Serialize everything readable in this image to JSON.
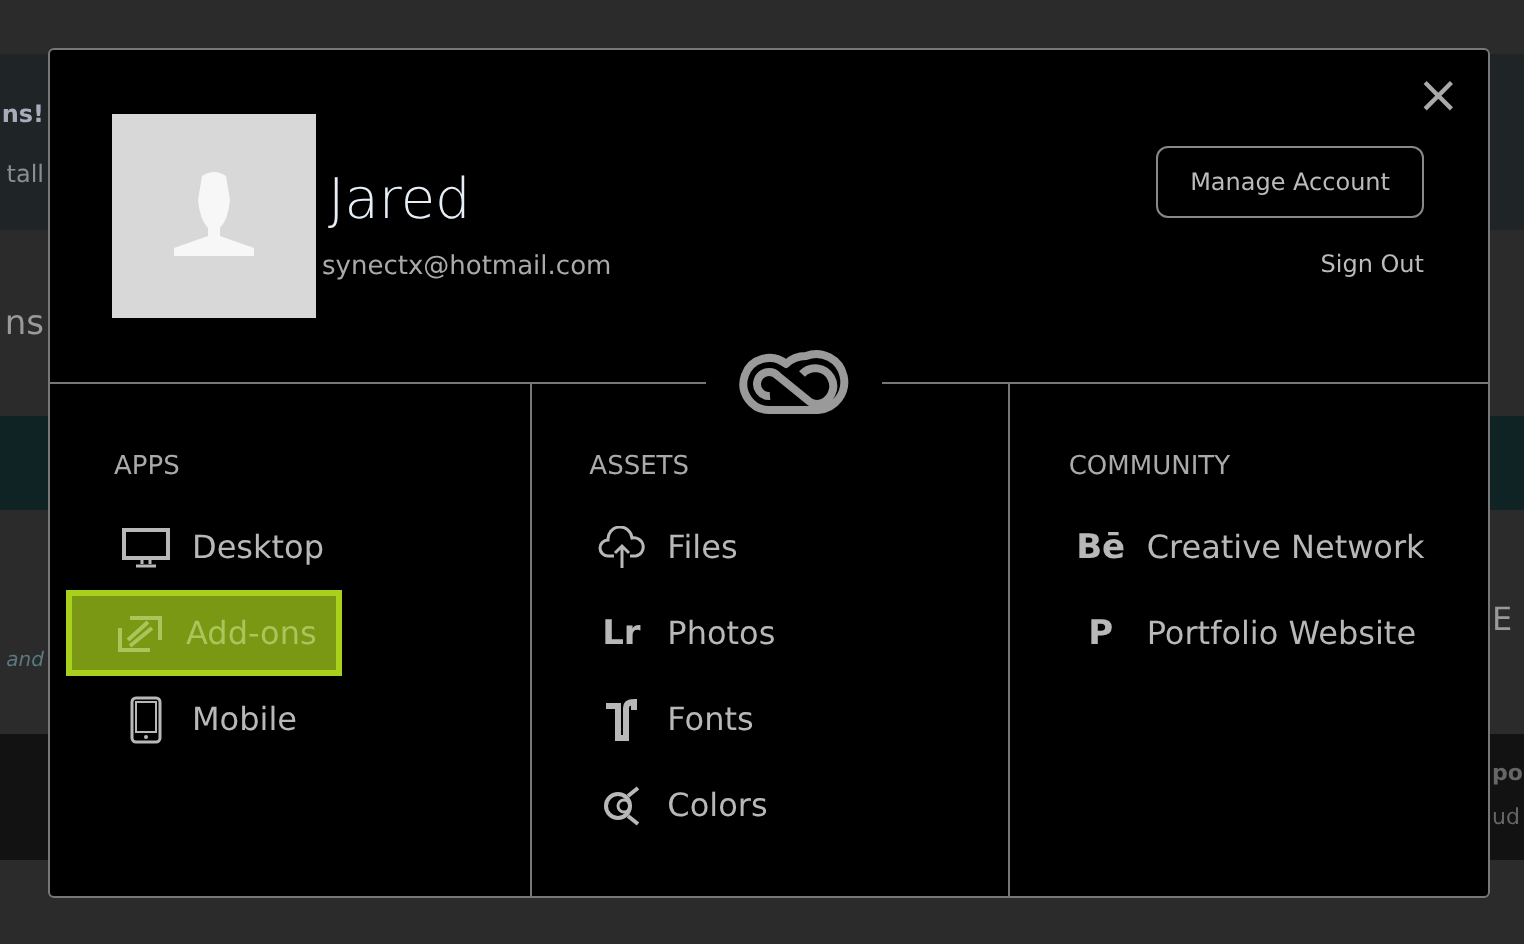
{
  "background_page": {
    "left_fragments": [
      "ns!",
      "tall",
      "ns",
      "and"
    ],
    "right_fragments": [
      "E",
      "po",
      "ud"
    ]
  },
  "account_panel": {
    "close_label": "×",
    "name": "Jared",
    "email": "synectx@hotmail.com",
    "manage_button": "Manage Account",
    "sign_out": "Sign Out",
    "columns": [
      {
        "heading": "APPS",
        "items": [
          {
            "label": "Desktop",
            "selected": false
          },
          {
            "label": "Add-ons",
            "selected": true
          },
          {
            "label": "Mobile",
            "selected": false
          }
        ]
      },
      {
        "heading": "ASSETS",
        "items": [
          {
            "label": "Files",
            "selected": false
          },
          {
            "label": "Photos",
            "glyph": "Lr",
            "selected": false
          },
          {
            "label": "Fonts",
            "selected": false
          },
          {
            "label": "Colors",
            "selected": false
          }
        ]
      },
      {
        "heading": "COMMUNITY",
        "items": [
          {
            "label": "Creative Network",
            "glyph": "Bē",
            "selected": false
          },
          {
            "label": "Portfolio Website",
            "glyph": "P",
            "selected": false
          }
        ]
      }
    ]
  }
}
